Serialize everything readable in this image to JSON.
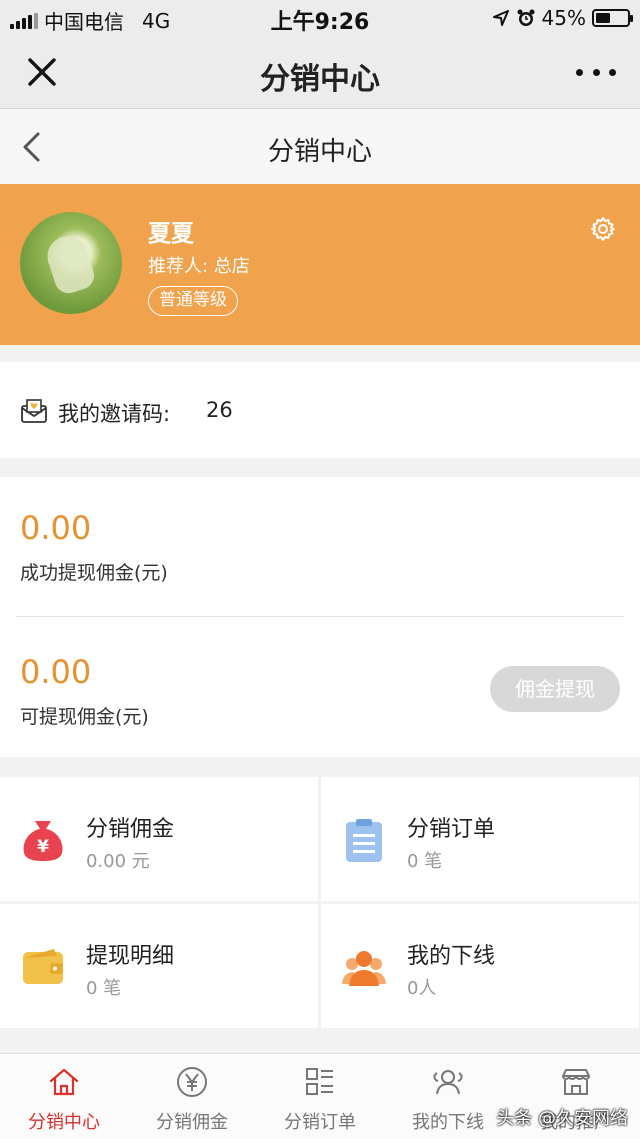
{
  "status_bar": {
    "carrier": "中国电信",
    "network": "4G",
    "time": "上午9:26",
    "battery_percent": "45%",
    "battery_level": 0.45
  },
  "wechat_header": {
    "title": "分销中心"
  },
  "nav": {
    "title": "分销中心"
  },
  "profile": {
    "name": "夏夏",
    "referrer": "推荐人: 总店",
    "level": "普通等级"
  },
  "invite": {
    "label": "我的邀请码:",
    "code": "26"
  },
  "earnings": {
    "success_amount": "0.00",
    "success_label": "成功提现佣金(元)",
    "available_amount": "0.00",
    "available_label": "可提现佣金(元)",
    "withdraw_button": "佣金提现"
  },
  "grid": [
    {
      "title": "分销佣金",
      "sub": "0.00 元",
      "icon": "money-bag-icon"
    },
    {
      "title": "分销订单",
      "sub": "0 笔",
      "icon": "clipboard-icon"
    },
    {
      "title": "提现明细",
      "sub": "0 笔",
      "icon": "wallet-icon"
    },
    {
      "title": "我的下线",
      "sub": "0人",
      "icon": "team-icon"
    }
  ],
  "tabs": [
    {
      "label": "分销中心",
      "icon": "home-icon",
      "active": true
    },
    {
      "label": "分销佣金",
      "icon": "yen-icon",
      "active": false
    },
    {
      "label": "分销订单",
      "icon": "list-icon",
      "active": false
    },
    {
      "label": "我的下线",
      "icon": "users-icon",
      "active": false
    },
    {
      "label": "我的推广",
      "icon": "store-icon",
      "active": false
    }
  ],
  "watermark": "头条 @久安网络",
  "colors": {
    "accent_orange": "#f0a24c",
    "amount_orange": "#e8912e",
    "active_tab_red": "#d9322e"
  }
}
